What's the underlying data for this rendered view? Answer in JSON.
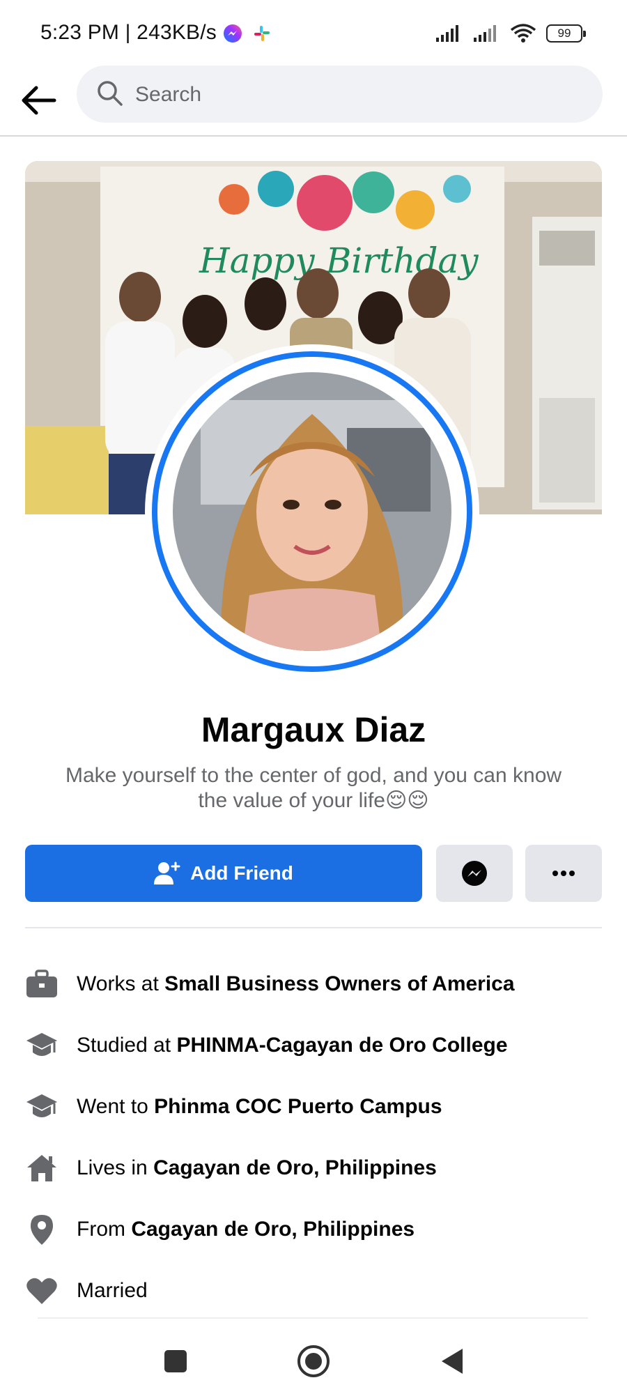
{
  "status_bar": {
    "time_speed": "5:23 PM | 243KB/s",
    "battery": "99",
    "icons": [
      "messenger-icon",
      "slack-icon",
      "signal-icon",
      "signal-icon",
      "wifi-icon",
      "battery-icon"
    ]
  },
  "header": {
    "search_placeholder": "Search"
  },
  "profile": {
    "name": "Margaux Diaz",
    "bio": "Make yourself to the center of god, and you can know the value of your life😌😌",
    "cover_banner_text": "Happy Birthday"
  },
  "actions": {
    "add_friend_label": "Add Friend"
  },
  "details": [
    {
      "icon": "briefcase-icon",
      "prefix": "Works at ",
      "value": "Small Business Owners of America"
    },
    {
      "icon": "graduation-cap-icon",
      "prefix": "Studied at ",
      "value": "PHINMA-Cagayan de Oro College"
    },
    {
      "icon": "graduation-cap-icon",
      "prefix": "Went to ",
      "value": "Phinma COC Puerto Campus"
    },
    {
      "icon": "home-icon",
      "prefix": "Lives in ",
      "value": "Cagayan de Oro, Philippines"
    },
    {
      "icon": "location-pin-icon",
      "prefix": "From ",
      "value": "Cagayan de Oro, Philippines"
    },
    {
      "icon": "heart-icon",
      "prefix": "Married",
      "value": ""
    }
  ],
  "colors": {
    "accent": "#1b6fe3",
    "ring": "#1877f2",
    "secondary_button": "#e4e6eb",
    "muted_text": "#65676b",
    "icon_gray": "#65676b"
  }
}
